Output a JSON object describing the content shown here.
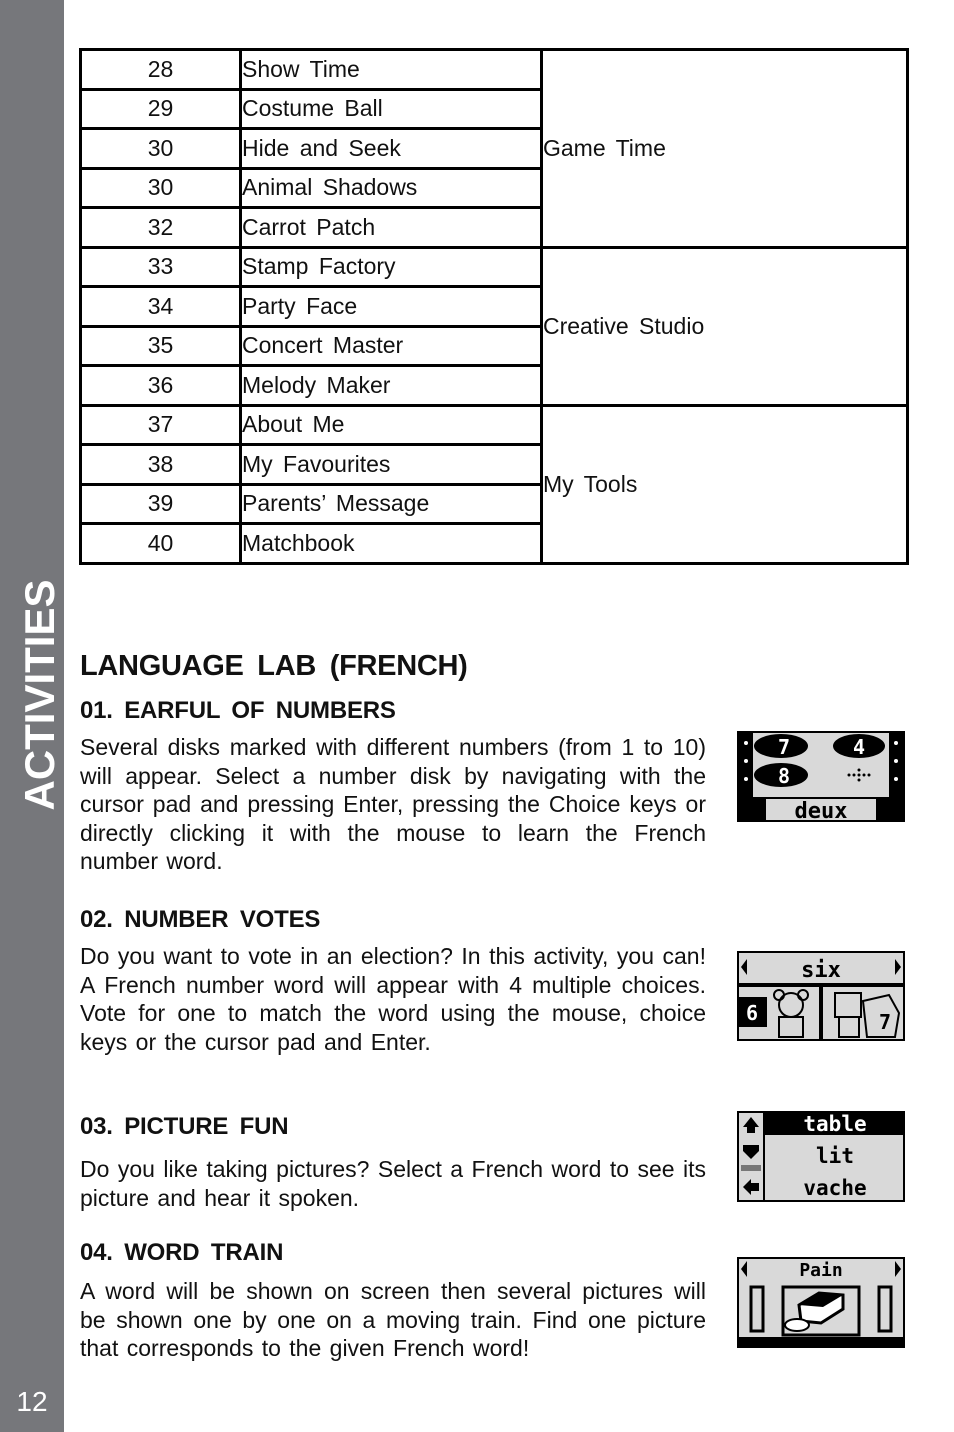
{
  "sidebar": {
    "section_label": "ACTIVITIES",
    "page_number": "12"
  },
  "table": {
    "groups": [
      {
        "category": "Game Time",
        "rows": [
          {
            "page": "28",
            "activity": "Show Time"
          },
          {
            "page": "29",
            "activity": "Costume Ball"
          },
          {
            "page": "30",
            "activity": "Hide and Seek"
          },
          {
            "page": "30",
            "activity": "Animal Shadows"
          },
          {
            "page": "32",
            "activity": "Carrot Patch"
          }
        ]
      },
      {
        "category": "Creative Studio",
        "rows": [
          {
            "page": "33",
            "activity": "Stamp Factory"
          },
          {
            "page": "34",
            "activity": "Party Face"
          },
          {
            "page": "35",
            "activity": "Concert Master"
          },
          {
            "page": "36",
            "activity": "Melody Maker"
          }
        ]
      },
      {
        "category": "My Tools",
        "rows": [
          {
            "page": "37",
            "activity": "About Me"
          },
          {
            "page": "38",
            "activity": "My Favourites"
          },
          {
            "page": "39",
            "activity": "Parents’ Message"
          },
          {
            "page": "40",
            "activity": "Matchbook"
          }
        ]
      }
    ]
  },
  "language_lab": {
    "title": "LANGUAGE LAB (FRENCH)",
    "sections": [
      {
        "heading": "01. EARFUL OF NUMBERS",
        "body": "Several disks marked with different numbers (from 1 to 10) will appear. Select a number disk by navigating with the cursor pad and pressing Enter, pressing the Choice keys or directly clicking it with the mouse to learn the French number word.",
        "screenshot": {
          "word": "deux",
          "disks": [
            "7",
            "4",
            "8"
          ]
        }
      },
      {
        "heading": "02. NUMBER VOTES",
        "body": "Do you want to vote in an election? In this activity, you can! A French number word will appear with 4 multiple choices. Vote for one to match the word using the mouse, choice keys or the cursor pad and Enter.",
        "screenshot": {
          "word": "six",
          "choices": [
            "6",
            "7"
          ]
        }
      },
      {
        "heading": "03. PICTURE FUN",
        "body": "Do you like taking pictures? Select a French word to see its picture and hear it spoken.",
        "screenshot": {
          "words": [
            "table",
            "lit",
            "vache"
          ]
        }
      },
      {
        "heading": "04. WORD TRAIN",
        "body": "A word will be shown on screen then several pictures will be shown one by one on a moving train. Find one picture that corresponds to the given French word!",
        "screenshot": {
          "word": "Pain"
        }
      }
    ]
  }
}
